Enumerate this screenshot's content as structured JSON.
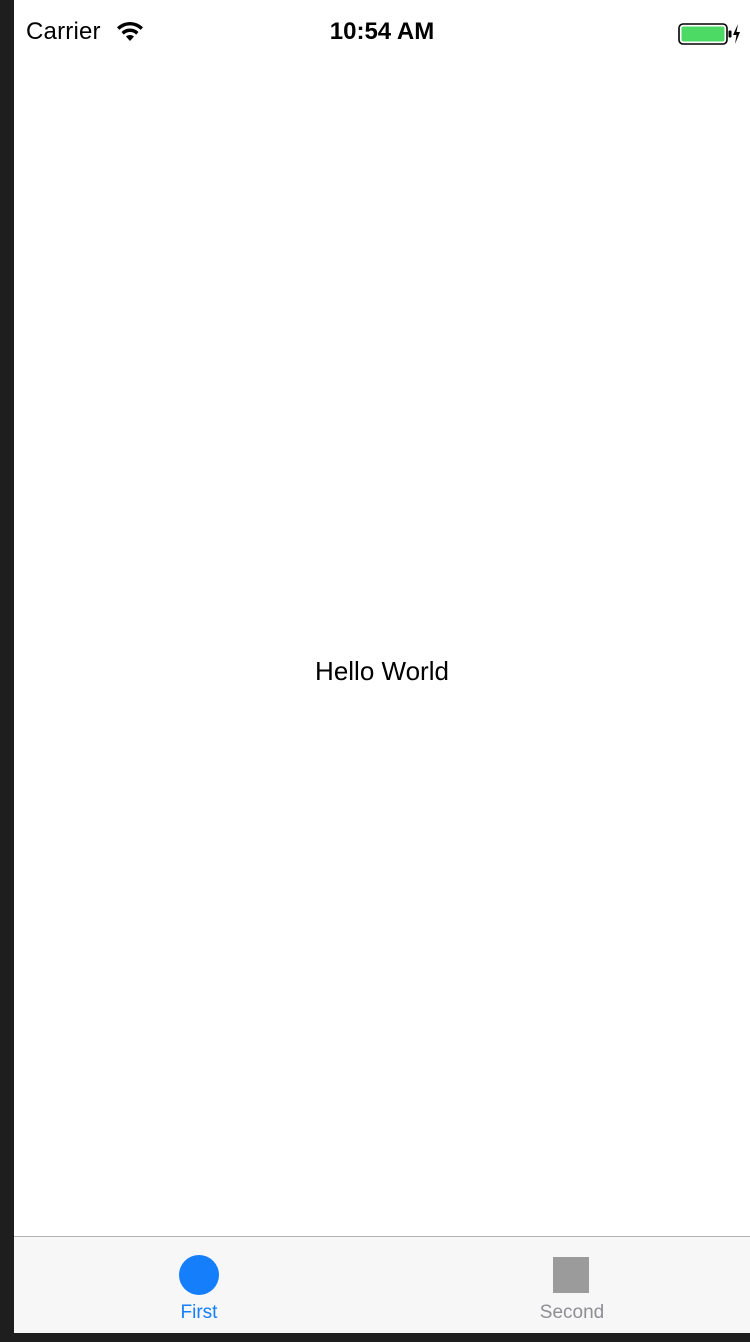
{
  "status_bar": {
    "carrier": "Carrier",
    "time": "10:54 AM",
    "wifi_icon": "wifi-icon",
    "battery_icon": "battery-charging-icon",
    "battery_color": "#4cd964"
  },
  "main": {
    "label": "Hello World"
  },
  "tab_bar": {
    "tabs": [
      {
        "label": "First",
        "icon": "circle-icon",
        "selected": true,
        "color": "#147efb"
      },
      {
        "label": "Second",
        "icon": "square-icon",
        "selected": false,
        "color": "#8e8e93"
      }
    ]
  }
}
